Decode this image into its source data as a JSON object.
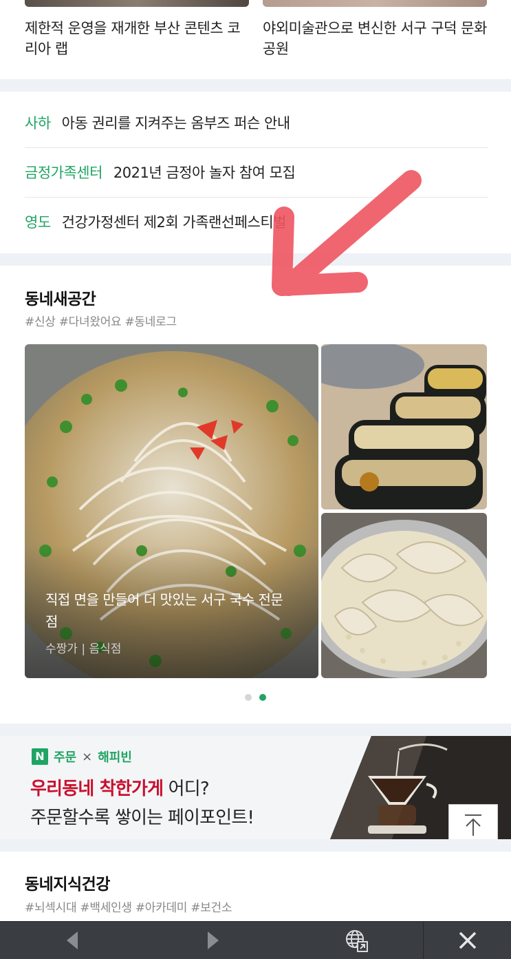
{
  "top_articles": [
    {
      "title": "제한적 운영을 재개한 부산 콘텐츠 코리아 랩"
    },
    {
      "title": "야외미술관으로 변신한 서구 구덕 문화공원"
    }
  ],
  "news": [
    {
      "tag": "사하",
      "text": "아동 권리를 지켜주는 옴부즈 퍼슨 안내"
    },
    {
      "tag": "금정가족센터",
      "text": "2021년 금정아 놀자 참여 모집"
    },
    {
      "tag": "영도",
      "text": "건강가정센터 제2회 가족랜선페스티벌"
    }
  ],
  "new_space": {
    "title": "동네새공간",
    "hashtags": "#신상 #다녀왔어요 #동네로그",
    "main_caption": "직접 면을 만들어 더 맛있는 서구 국수 전문점",
    "main_meta": "수짱가 | 음식점",
    "pagination_total": 2,
    "pagination_active": 2
  },
  "banner": {
    "n_logo": "N",
    "brand1": "주문",
    "times": "×",
    "brand2": "해피빈",
    "highlight": "우리동네 착한가게",
    "line1_rest": " 어디?",
    "line2": "주문할수록 쌓이는 페이포인트!"
  },
  "health": {
    "title": "동네지식건강",
    "hashtags": "#뇌섹시대 #백세인생 #아카데미 #보건소"
  },
  "colors": {
    "accent_green": "#1fa463",
    "annotation_arrow": "#ee5561",
    "banner_red": "#c8102e",
    "separator": "#eef1f6",
    "bottom_bar": "#3a3d42"
  },
  "icons": {
    "scroll_top": "arrow-up-icon",
    "back": "chevron-left-icon",
    "forward": "chevron-right-icon",
    "web": "globe-icon",
    "close": "close-icon"
  }
}
